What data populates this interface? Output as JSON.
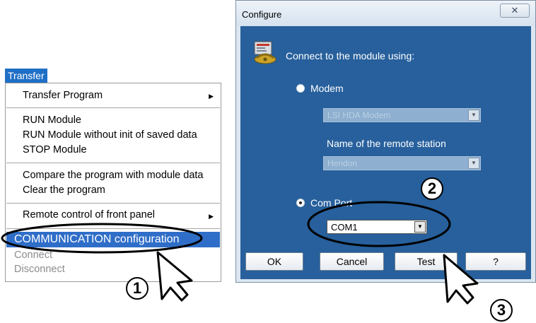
{
  "menu": {
    "title": "Transfer",
    "items": [
      {
        "label": "Transfer Program"
      },
      {
        "label": "RUN Module"
      },
      {
        "label": "RUN Module without init of saved data"
      },
      {
        "label": "STOP Module"
      },
      {
        "label": "Compare the program with module data"
      },
      {
        "label": "Clear the program"
      },
      {
        "label": "Remote control of front panel"
      },
      {
        "label": "COMMUNICATION  configuration"
      },
      {
        "label": "Connect"
      },
      {
        "label": "Disconnect"
      }
    ]
  },
  "dialog": {
    "title": "Configure",
    "close_glyph": "✕",
    "heading": "Connect to the module using:",
    "modem_label": "Modem",
    "modem_device": "LSI HDA Modem",
    "remote_station_label": "Name of the remote station",
    "remote_station_value": "Hendon",
    "com_port_label": "Com Port",
    "com_port_value": "COM1",
    "buttons": {
      "ok": "OK",
      "cancel": "Cancel",
      "test": "Test",
      "help": "?"
    }
  },
  "annotations": {
    "step1": "1",
    "step2": "2",
    "step3": "3"
  }
}
